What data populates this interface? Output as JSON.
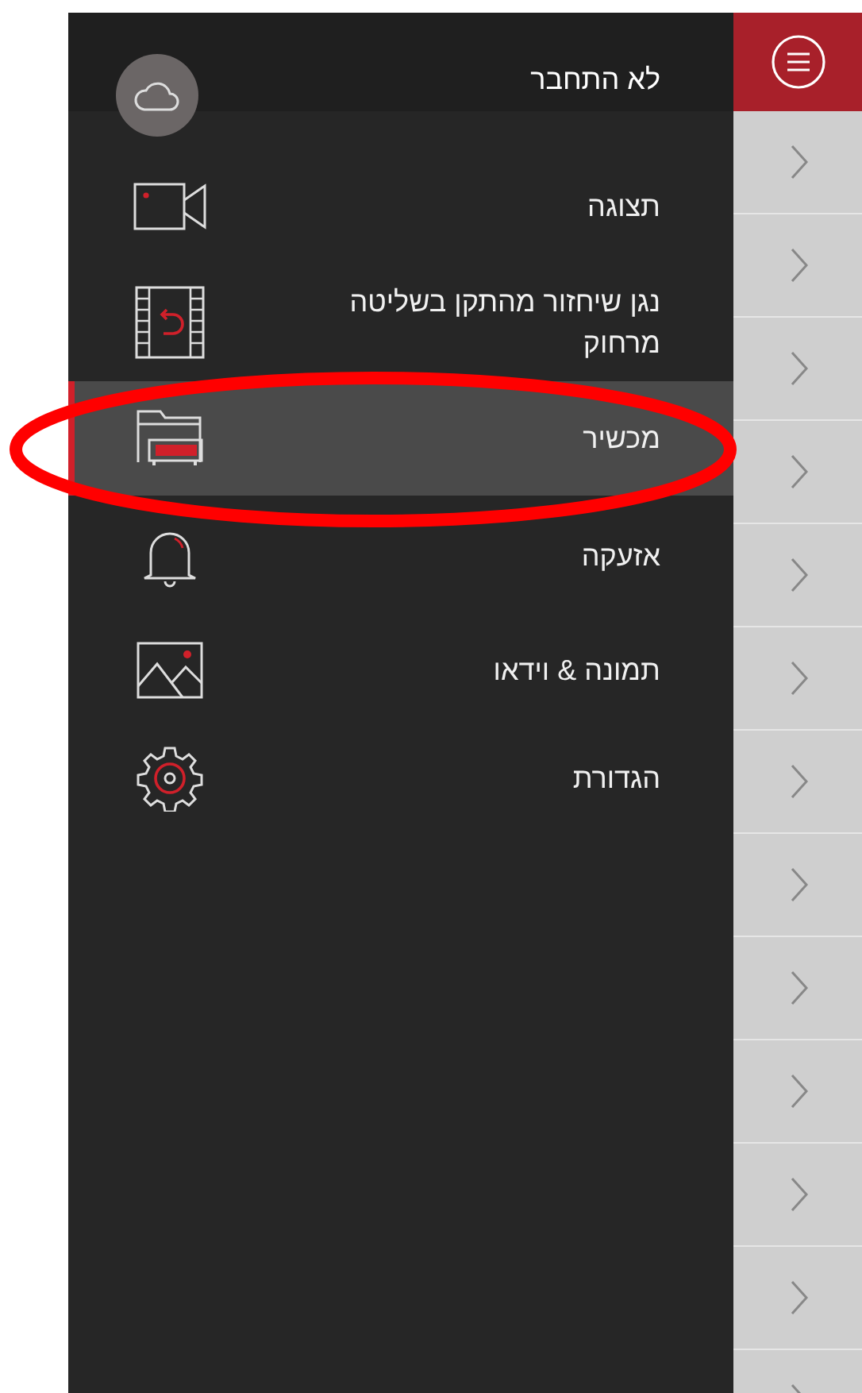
{
  "drawer": {
    "account": {
      "label": "לא התחבר"
    },
    "items": [
      {
        "kind": "camera",
        "label": "תצוגה",
        "selected": false
      },
      {
        "kind": "playback",
        "label": "נגן שיחזור מהתקן בשליטה מרחוק",
        "selected": false
      },
      {
        "kind": "device",
        "label": "מכשיר",
        "selected": true
      },
      {
        "kind": "alarm",
        "label": "אזעקה",
        "selected": false
      },
      {
        "kind": "media",
        "label": "תמונה & וידאו",
        "selected": false
      },
      {
        "kind": "settings",
        "label": "הגדורת",
        "selected": false
      }
    ]
  }
}
